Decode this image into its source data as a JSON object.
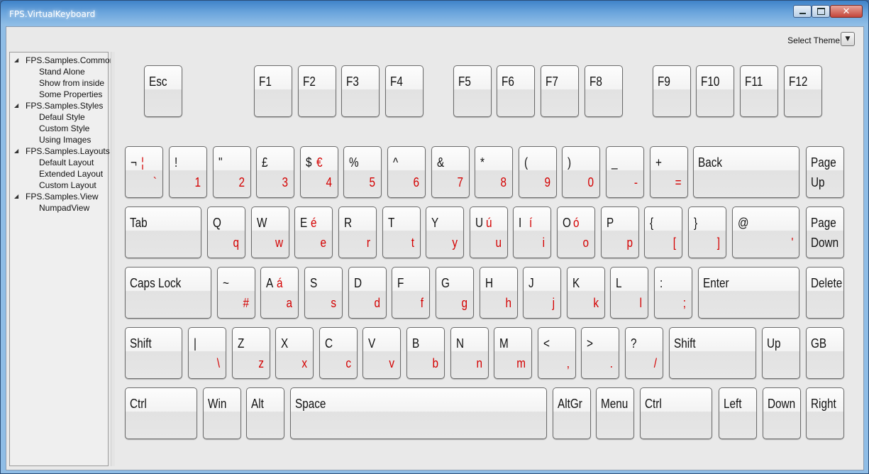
{
  "window": {
    "title": "FPS.VirtualKeyboard"
  },
  "theme": {
    "label": "Select Theme"
  },
  "tree": [
    {
      "label": "FPS.Samples.Common",
      "type": "group"
    },
    {
      "label": "Stand Alone",
      "type": "leaf"
    },
    {
      "label": "Show from inside",
      "type": "leaf"
    },
    {
      "label": "Some Properties",
      "type": "leaf"
    },
    {
      "label": "FPS.Samples.Styles",
      "type": "group"
    },
    {
      "label": "Defaul Style",
      "type": "leaf"
    },
    {
      "label": "Custom Style",
      "type": "leaf"
    },
    {
      "label": "Using Images",
      "type": "leaf"
    },
    {
      "label": "FPS.Samples.Layouts",
      "type": "group"
    },
    {
      "label": "Default Layout",
      "type": "leaf"
    },
    {
      "label": "Extended Layout",
      "type": "leaf"
    },
    {
      "label": "Custom Layout",
      "type": "leaf"
    },
    {
      "label": "FPS.Samples.View",
      "type": "group"
    },
    {
      "label": "NumpadView",
      "type": "leaf"
    }
  ],
  "keys": [
    {
      "id": "esc",
      "main": "Esc"
    },
    {
      "id": "f1",
      "main": "F1"
    },
    {
      "id": "f2",
      "main": "F2"
    },
    {
      "id": "f3",
      "main": "F3"
    },
    {
      "id": "f4",
      "main": "F4"
    },
    {
      "id": "f5",
      "main": "F5"
    },
    {
      "id": "f6",
      "main": "F6"
    },
    {
      "id": "f7",
      "main": "F7"
    },
    {
      "id": "f8",
      "main": "F8"
    },
    {
      "id": "f9",
      "main": "F9"
    },
    {
      "id": "f10",
      "main": "F10"
    },
    {
      "id": "f11",
      "main": "F11"
    },
    {
      "id": "f12",
      "main": "F12"
    },
    {
      "id": "backtick",
      "shift": "¬",
      "altgr": "¦",
      "lower": "`"
    },
    {
      "id": "1",
      "shift": "!",
      "lower": "1"
    },
    {
      "id": "2",
      "shift": "\"",
      "lower": "2"
    },
    {
      "id": "3",
      "shift": "£",
      "lower": "3"
    },
    {
      "id": "4",
      "shift": "$",
      "altgr": "€",
      "lower": "4"
    },
    {
      "id": "5",
      "shift": "%",
      "lower": "5"
    },
    {
      "id": "6",
      "shift": "^",
      "lower": "6"
    },
    {
      "id": "7",
      "shift": "&",
      "lower": "7"
    },
    {
      "id": "8",
      "shift": "*",
      "lower": "8"
    },
    {
      "id": "9",
      "shift": "(",
      "lower": "9"
    },
    {
      "id": "0",
      "shift": ")",
      "lower": "0"
    },
    {
      "id": "minus",
      "shift": "_",
      "lower": "-"
    },
    {
      "id": "equals",
      "shift": "+",
      "lower": "="
    },
    {
      "id": "back",
      "main": "Back"
    },
    {
      "id": "pageup",
      "main": "Page",
      "main2": "Up"
    },
    {
      "id": "tab",
      "main": "Tab"
    },
    {
      "id": "q",
      "shift": "Q",
      "lower": "q"
    },
    {
      "id": "w",
      "shift": "W",
      "lower": "w"
    },
    {
      "id": "e",
      "shift": "E",
      "altgr": "é",
      "lower": "e"
    },
    {
      "id": "r",
      "shift": "R",
      "lower": "r"
    },
    {
      "id": "t",
      "shift": "T",
      "lower": "t"
    },
    {
      "id": "y",
      "shift": "Y",
      "lower": "y"
    },
    {
      "id": "u",
      "shift": "U",
      "altgr": "ú",
      "lower": "u"
    },
    {
      "id": "i",
      "shift": "I",
      "altgr": "í",
      "lower": "i"
    },
    {
      "id": "o",
      "shift": "O",
      "altgr": "ó",
      "lower": "o"
    },
    {
      "id": "p",
      "shift": "P",
      "lower": "p"
    },
    {
      "id": "lbracket",
      "shift": "{",
      "lower": "["
    },
    {
      "id": "rbracket",
      "shift": "}",
      "lower": "]"
    },
    {
      "id": "quote",
      "shift": "@",
      "lower": "'"
    },
    {
      "id": "pagedown",
      "main": "Page",
      "main2": "Down"
    },
    {
      "id": "capslock",
      "main": "Caps Lock"
    },
    {
      "id": "hash",
      "shift": "~",
      "lower": "#"
    },
    {
      "id": "a",
      "shift": "A",
      "altgr": "á",
      "lower": "a"
    },
    {
      "id": "s",
      "shift": "S",
      "lower": "s"
    },
    {
      "id": "d",
      "shift": "D",
      "lower": "d"
    },
    {
      "id": "f",
      "shift": "F",
      "lower": "f"
    },
    {
      "id": "g",
      "shift": "G",
      "lower": "g"
    },
    {
      "id": "h",
      "shift": "H",
      "lower": "h"
    },
    {
      "id": "j",
      "shift": "J",
      "lower": "j"
    },
    {
      "id": "k",
      "shift": "K",
      "lower": "k"
    },
    {
      "id": "l",
      "shift": "L",
      "lower": "l"
    },
    {
      "id": "semicolon",
      "shift": ":",
      "lower": ";"
    },
    {
      "id": "enter",
      "main": "Enter"
    },
    {
      "id": "delete",
      "main": "Delete"
    },
    {
      "id": "lshift",
      "main": "Shift"
    },
    {
      "id": "backslash",
      "shift": "|",
      "lower": "\\"
    },
    {
      "id": "z",
      "shift": "Z",
      "lower": "z"
    },
    {
      "id": "x",
      "shift": "X",
      "lower": "x"
    },
    {
      "id": "c",
      "shift": "C",
      "lower": "c"
    },
    {
      "id": "v",
      "shift": "V",
      "lower": "v"
    },
    {
      "id": "b",
      "shift": "B",
      "lower": "b"
    },
    {
      "id": "n",
      "shift": "N",
      "lower": "n"
    },
    {
      "id": "m",
      "shift": "M",
      "lower": "m"
    },
    {
      "id": "comma",
      "shift": "<",
      "lower": ","
    },
    {
      "id": "period",
      "shift": ">",
      "lower": "."
    },
    {
      "id": "slash",
      "shift": "?",
      "lower": "/"
    },
    {
      "id": "rshift",
      "main": "Shift"
    },
    {
      "id": "up",
      "main": "Up"
    },
    {
      "id": "gb",
      "main": "GB"
    },
    {
      "id": "lctrl",
      "main": "Ctrl"
    },
    {
      "id": "win",
      "main": "Win"
    },
    {
      "id": "alt",
      "main": "Alt"
    },
    {
      "id": "space",
      "main": "Space"
    },
    {
      "id": "altgr",
      "main": "AltGr"
    },
    {
      "id": "menu",
      "main": "Menu"
    },
    {
      "id": "rctrl",
      "main": "Ctrl"
    },
    {
      "id": "left",
      "main": "Left"
    },
    {
      "id": "down",
      "main": "Down"
    },
    {
      "id": "right",
      "main": "Right"
    }
  ]
}
